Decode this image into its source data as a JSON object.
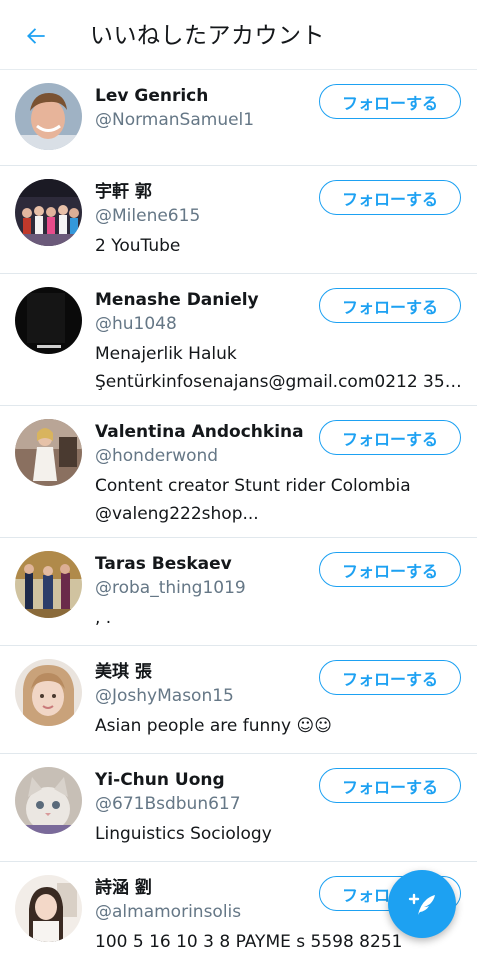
{
  "header": {
    "title": "いいねしたアカウント",
    "back_icon": "arrow-left-icon"
  },
  "colors": {
    "accent": "#1da1f2",
    "secondary_text": "#657786",
    "divider": "#e1e8ed"
  },
  "follow_label": "フォローする",
  "users": [
    {
      "name": "Lev Genrich",
      "handle": "@NormanSamuel1",
      "bio": []
    },
    {
      "name": "宇軒 郭",
      "handle": "@Milene615",
      "bio": [
        "2 YouTube"
      ]
    },
    {
      "name": "Menashe Daniely",
      "handle": "@hu1048",
      "bio": [
        "Menajerlik Haluk",
        "Şentürkinfosenajans@gmail.com0212 352..."
      ]
    },
    {
      "name": "Valentina Andochkina",
      "handle": "@honderwond",
      "bio": [
        "Content creator Stunt rider Colombia",
        "@valeng222shop..."
      ]
    },
    {
      "name": "Taras Beskaev",
      "handle": "@roba_thing1019",
      "bio": [
        ", ."
      ]
    },
    {
      "name": "美琪 張",
      "handle": "@JoshyMason15",
      "bio": [
        "Asian people are funny ☺☺"
      ]
    },
    {
      "name": "Yi-Chun Uong",
      "handle": "@671Bsdbun617",
      "bio": [
        "Linguistics Sociology"
      ]
    },
    {
      "name": "詩涵 劉",
      "handle": "@almamorinsolis",
      "bio": [
        "100 5 16 10 3 8 PAYME s 5598 8251"
      ]
    }
  ],
  "fab": {
    "icon": "compose-feather-icon"
  }
}
